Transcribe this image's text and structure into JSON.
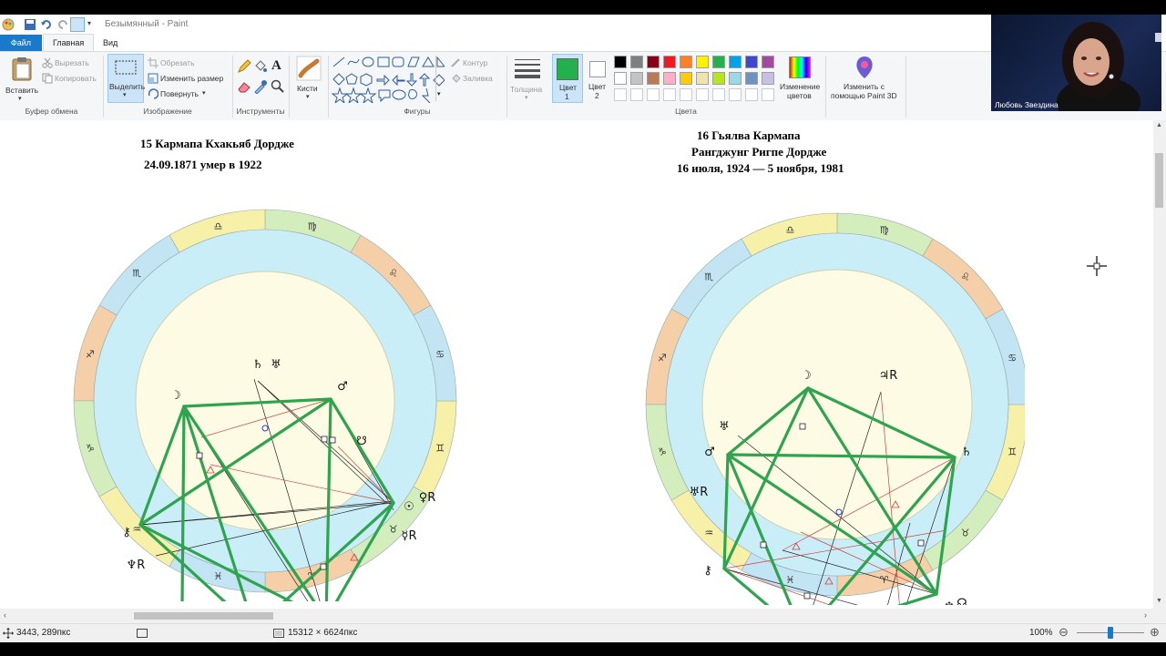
{
  "app": {
    "title": "Безымянный - Paint",
    "tabs": {
      "file": "Файл",
      "home": "Главная",
      "view": "Вид"
    }
  },
  "ribbon": {
    "clipboard": {
      "paste": "Вставить",
      "cut": "Вырезать",
      "copy": "Копировать",
      "label": "Буфер обмена"
    },
    "image": {
      "select": "Выделить",
      "crop": "Обрезать",
      "resize": "Изменить размер",
      "rotate": "Повернуть",
      "label": "Изображение"
    },
    "tools": {
      "label": "Инструменты"
    },
    "brushes": {
      "label": "Кисти"
    },
    "shapes": {
      "outline": "Контур",
      "fill": "Заливка",
      "label": "Фигуры"
    },
    "size": {
      "label": "Толщина"
    },
    "color1": {
      "label": "Цвет",
      "num": "1",
      "value": "#22b14c"
    },
    "color2": {
      "label": "Цвет",
      "num": "2",
      "value": "#ffffff"
    },
    "colors_label": "Цвета",
    "edit_colors": {
      "line1": "Изменение",
      "line2": "цветов"
    },
    "paint3d": {
      "line1": "Изменить с",
      "line2": "помощью Paint 3D"
    },
    "palette_row1": [
      "#000000",
      "#7f7f7f",
      "#880015",
      "#ed1c24",
      "#ff7f27",
      "#fff200",
      "#22b14c",
      "#00a2e8",
      "#3f48cc",
      "#a349a4"
    ],
    "palette_row2": [
      "#ffffff",
      "#c3c3c3",
      "#b97a57",
      "#ffaec9",
      "#ffc90e",
      "#efe4b0",
      "#b5e61d",
      "#99d9ea",
      "#7092be",
      "#c8bfe7"
    ]
  },
  "canvas": {
    "chart1": {
      "title_line1": "15 Кармапа  Кхакьяб Дордже",
      "title_line2": "24.09.1871 умер в  1922"
    },
    "chart2": {
      "title_line1": "16 Гьялва Кармапа",
      "title_line2": "Рангджунг Ригпе Дордже",
      "title_line3": "16 июля, 1924 — 5 ноября, 1981"
    }
  },
  "zodiac_glyphs": [
    "♈",
    "♉",
    "♊",
    "♋",
    "♌",
    "♍",
    "♎",
    "♏",
    "♐",
    "♑",
    "♒",
    "♓"
  ],
  "chart1_planets": [
    "♄",
    "♅",
    "♂",
    "♀R",
    "☉",
    "☿R",
    "♃",
    "♅",
    "⚷",
    "♆R",
    "♇R",
    "☊",
    "⚸",
    "☽",
    "☋"
  ],
  "chart2_planets": [
    "☽",
    "♃R",
    "♄",
    "♅",
    "♂",
    "♅R",
    "⚷",
    "♆",
    "☊",
    "☿",
    "☉",
    "♀R",
    "♇",
    "⚸"
  ],
  "status": {
    "cursor": "3443, 289пкс",
    "dimensions": "15312 × 6624пкс",
    "zoom": "100%"
  },
  "webcam": {
    "name": "Любовь Звездина"
  }
}
